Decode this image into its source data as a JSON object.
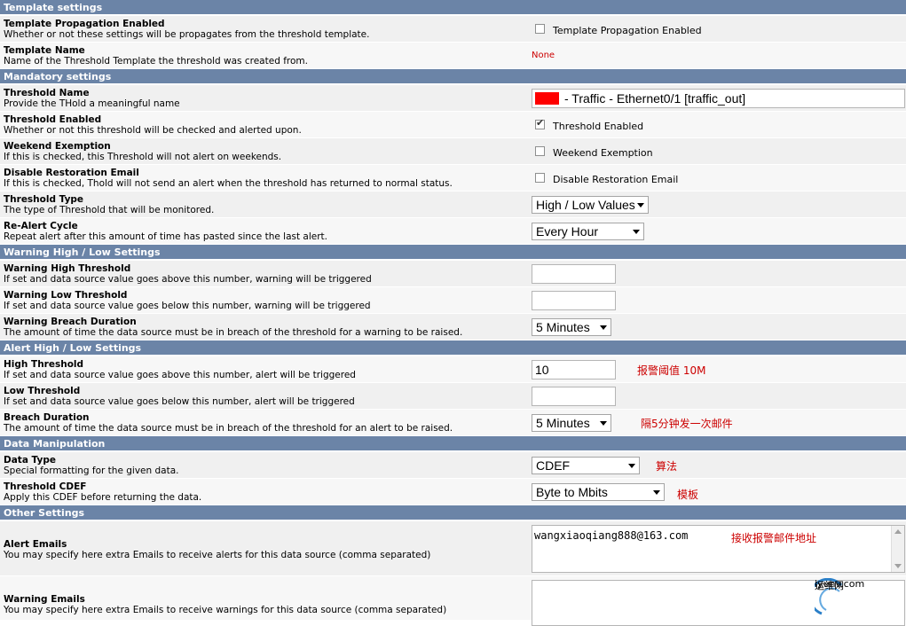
{
  "sections": {
    "template": "Template settings",
    "mandatory": "Mandatory settings",
    "warning": "Warning High / Low Settings",
    "alert": "Alert High / Low Settings",
    "data": "Data Manipulation",
    "other": "Other Settings"
  },
  "rows": {
    "propagation": {
      "title": "Template Propagation Enabled",
      "desc": "Whether or not these settings will be propagates from the threshold template.",
      "checkbox_label": "Template Propagation Enabled",
      "checked": false
    },
    "template_name": {
      "title": "Template Name",
      "desc": "Name of the Threshold Template the threshold was created from.",
      "value": "None"
    },
    "thold_name": {
      "title": "Threshold Name",
      "desc": "Provide the THold a meaningful name",
      "value": "- Traffic - Ethernet0/1 [traffic_out]",
      "swatch_color": "#ff0000"
    },
    "thold_enabled": {
      "title": "Threshold Enabled",
      "desc": "Whether or not this threshold will be checked and alerted upon.",
      "checkbox_label": "Threshold Enabled",
      "checked": true
    },
    "weekend": {
      "title": "Weekend Exemption",
      "desc": "If this is checked, this Threshold will not alert on weekends.",
      "checkbox_label": "Weekend Exemption",
      "checked": false
    },
    "restoration": {
      "title": "Disable Restoration Email",
      "desc": "If this is checked, Thold will not send an alert when the threshold has returned to normal status.",
      "checkbox_label": "Disable Restoration Email",
      "checked": false
    },
    "thold_type": {
      "title": "Threshold Type",
      "desc": "The type of Threshold that will be monitored.",
      "value": "High / Low Values"
    },
    "realert": {
      "title": "Re-Alert Cycle",
      "desc": "Repeat alert after this amount of time has pasted since the last alert.",
      "value": "Every Hour"
    },
    "warn_high": {
      "title": "Warning High Threshold",
      "desc": "If set and data source value goes above this number, warning will be triggered",
      "value": ""
    },
    "warn_low": {
      "title": "Warning Low Threshold",
      "desc": "If set and data source value goes below this number, warning will be triggered",
      "value": ""
    },
    "warn_breach": {
      "title": "Warning Breach Duration",
      "desc": "The amount of time the data source must be in breach of the threshold for a warning to be raised.",
      "value": "5 Minutes"
    },
    "high": {
      "title": "High Threshold",
      "desc": "If set and data source value goes above this number, alert will be triggered",
      "value": "10",
      "note": "报警阈值 10M"
    },
    "low": {
      "title": "Low Threshold",
      "desc": "If set and data source value goes below this number, alert will be triggered",
      "value": ""
    },
    "breach": {
      "title": "Breach Duration",
      "desc": "The amount of time the data source must be in breach of the threshold for an alert to be raised.",
      "value": "5 Minutes",
      "note": "隔5分钟发一次邮件"
    },
    "data_type": {
      "title": "Data Type",
      "desc": "Special formatting for the given data.",
      "value": "CDEF",
      "note": "算法"
    },
    "cdef": {
      "title": "Threshold CDEF",
      "desc": "Apply this CDEF before returning the data.",
      "value": "Byte to Mbits",
      "note": "模板"
    },
    "alert_emails": {
      "title": "Alert Emails",
      "desc": "You may specify here extra Emails to receive alerts for this data source (comma separated)",
      "value": "wangxiaoqiang888@163.com",
      "note": "接收报警邮件地址"
    },
    "warn_emails": {
      "title": "Warning Emails",
      "desc": "You may specify here extra Emails to receive warnings for this data source (comma separated)",
      "value": ""
    }
  },
  "watermark": {
    "name": "运维网",
    "domain": "iyunv.com"
  }
}
